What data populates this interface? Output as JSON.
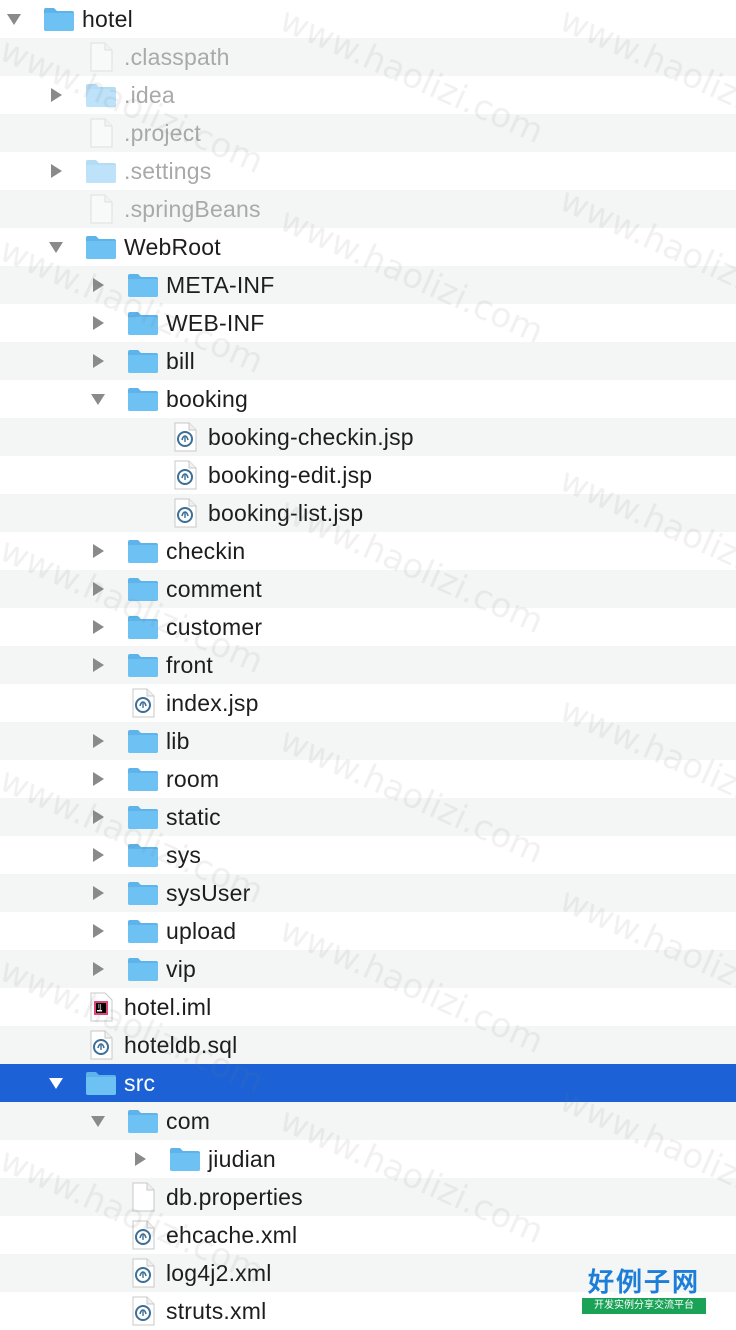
{
  "rows": [
    {
      "name": "hotel",
      "type": "folder",
      "arrow": "expanded",
      "depth": 0
    },
    {
      "name": ".classpath",
      "type": "file",
      "arrow": "none",
      "depth": 1,
      "dim": true
    },
    {
      "name": ".idea",
      "type": "folder",
      "arrow": "collapsed",
      "depth": 1,
      "dim": true
    },
    {
      "name": ".project",
      "type": "file",
      "arrow": "none",
      "depth": 1,
      "dim": true
    },
    {
      "name": ".settings",
      "type": "folder",
      "arrow": "collapsed",
      "depth": 1,
      "dim": true
    },
    {
      "name": ".springBeans",
      "type": "file",
      "arrow": "none",
      "depth": 1,
      "dim": true
    },
    {
      "name": "WebRoot",
      "type": "folder",
      "arrow": "expanded",
      "depth": 1
    },
    {
      "name": "META-INF",
      "type": "folder",
      "arrow": "collapsed",
      "depth": 2
    },
    {
      "name": "WEB-INF",
      "type": "folder",
      "arrow": "collapsed",
      "depth": 2
    },
    {
      "name": "bill",
      "type": "folder",
      "arrow": "collapsed",
      "depth": 2
    },
    {
      "name": "booking",
      "type": "folder",
      "arrow": "expanded",
      "depth": 2
    },
    {
      "name": "booking-checkin.jsp",
      "type": "web",
      "arrow": "none",
      "depth": 3
    },
    {
      "name": "booking-edit.jsp",
      "type": "web",
      "arrow": "none",
      "depth": 3
    },
    {
      "name": "booking-list.jsp",
      "type": "web",
      "arrow": "none",
      "depth": 3
    },
    {
      "name": "checkin",
      "type": "folder",
      "arrow": "collapsed",
      "depth": 2
    },
    {
      "name": "comment",
      "type": "folder",
      "arrow": "collapsed",
      "depth": 2
    },
    {
      "name": "customer",
      "type": "folder",
      "arrow": "collapsed",
      "depth": 2
    },
    {
      "name": "front",
      "type": "folder",
      "arrow": "collapsed",
      "depth": 2
    },
    {
      "name": "index.jsp",
      "type": "web",
      "arrow": "none",
      "depth": 2
    },
    {
      "name": "lib",
      "type": "folder",
      "arrow": "collapsed",
      "depth": 2
    },
    {
      "name": "room",
      "type": "folder",
      "arrow": "collapsed",
      "depth": 2
    },
    {
      "name": "static",
      "type": "folder",
      "arrow": "collapsed",
      "depth": 2
    },
    {
      "name": "sys",
      "type": "folder",
      "arrow": "collapsed",
      "depth": 2
    },
    {
      "name": "sysUser",
      "type": "folder",
      "arrow": "collapsed",
      "depth": 2
    },
    {
      "name": "upload",
      "type": "folder",
      "arrow": "collapsed",
      "depth": 2
    },
    {
      "name": "vip",
      "type": "folder",
      "arrow": "collapsed",
      "depth": 2
    },
    {
      "name": "hotel.iml",
      "type": "intellij",
      "arrow": "none",
      "depth": 1
    },
    {
      "name": "hoteldb.sql",
      "type": "web",
      "arrow": "none",
      "depth": 1
    },
    {
      "name": "src",
      "type": "folder",
      "arrow": "expanded",
      "depth": 1,
      "selected": true
    },
    {
      "name": "com",
      "type": "folder",
      "arrow": "expanded",
      "depth": 2
    },
    {
      "name": "jiudian",
      "type": "folder",
      "arrow": "collapsed",
      "depth": 3
    },
    {
      "name": "db.properties",
      "type": "file",
      "arrow": "none",
      "depth": 2
    },
    {
      "name": "ehcache.xml",
      "type": "web",
      "arrow": "none",
      "depth": 2
    },
    {
      "name": "log4j2.xml",
      "type": "web",
      "arrow": "none",
      "depth": 2
    },
    {
      "name": "struts.xml",
      "type": "web",
      "arrow": "none",
      "depth": 2
    }
  ],
  "colors": {
    "selection": "#1c62d6",
    "folder": "#6ec1f3",
    "folder_tab": "#5db3ea",
    "stripe": "#f4f5f5"
  },
  "watermark": "www.haolizi.com",
  "logo": {
    "big": "好例子网",
    "small": "开发实例分享交流平台"
  }
}
